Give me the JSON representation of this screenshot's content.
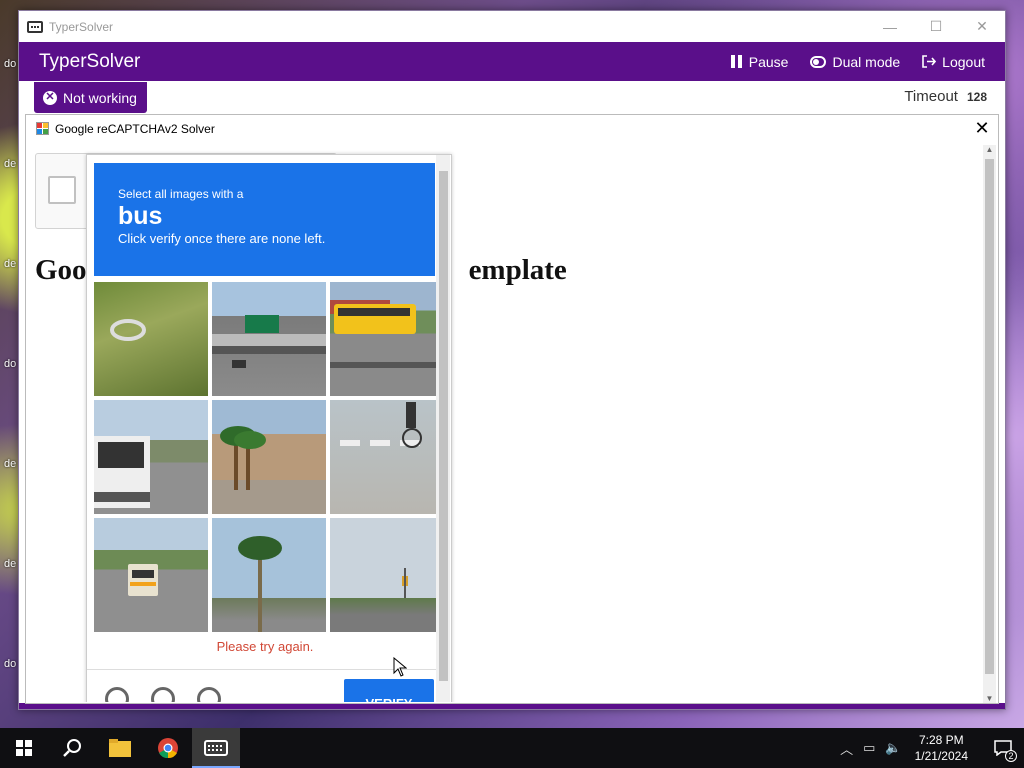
{
  "window": {
    "title": "TyperSolver",
    "app_title": "TyperSolver",
    "controls": {
      "minimize": "—",
      "maximize": "☐",
      "close": "✕"
    },
    "header_actions": [
      {
        "label": "Pause",
        "icon": "pause-icon"
      },
      {
        "label": "Dual mode",
        "icon": "toggle-icon"
      },
      {
        "label": "Logout",
        "icon": "logout-icon"
      }
    ],
    "status_badge": "Not working",
    "timeout_label": "Timeout",
    "timeout_value": "128",
    "accent_color": "#5a0f8a"
  },
  "solver": {
    "title": "Google reCAPTCHAv2 Solver",
    "close": "✕",
    "page_heading_left": "Goo",
    "page_heading_right": "emplate",
    "challenge": {
      "instruction_line1": "Select all images with a",
      "target": "bus",
      "instruction_line2": "Click verify once there are none left.",
      "error": "Please try again.",
      "verify_label": "VERIFY",
      "tiles": [
        "grass-field",
        "highway-overpass",
        "school-bus-road",
        "bus-street",
        "palm-trees-building",
        "cyclist-crosswalk",
        "road-with-school-bus",
        "palm-tree-sky",
        "road-intersection"
      ]
    }
  },
  "taskbar": {
    "time": "7:28 PM",
    "date": "1/21/2024",
    "notification_count": "2",
    "apps": [
      "start-icon",
      "search-icon",
      "file-explorer-icon",
      "chrome-icon",
      "typersolver-icon"
    ]
  }
}
